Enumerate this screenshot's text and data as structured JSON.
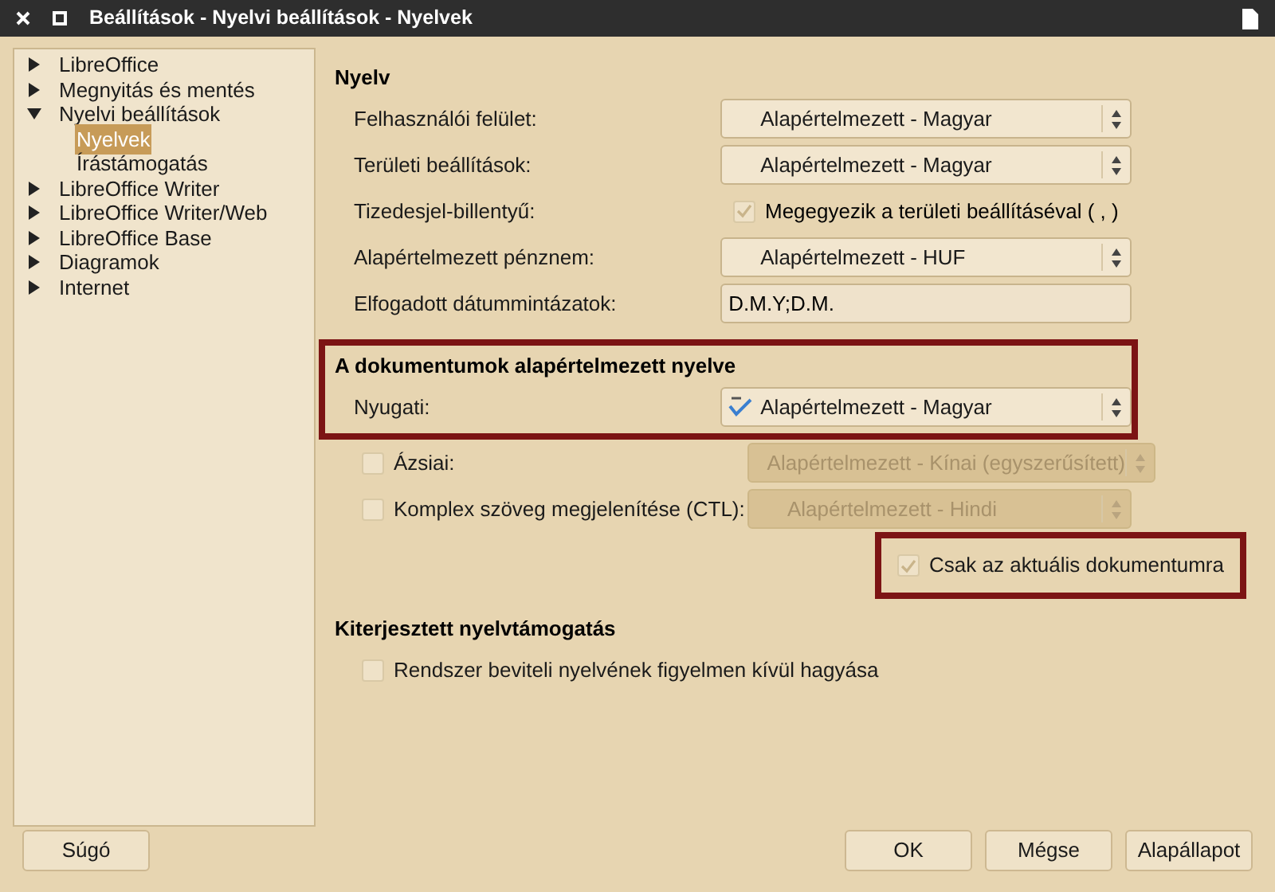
{
  "window": {
    "title": "Beállítások - Nyelvi beállítások - Nyelvek"
  },
  "tree": [
    {
      "label": "LibreOffice",
      "expanded": false,
      "selected": false
    },
    {
      "label": "Megnyitás és mentés",
      "expanded": false,
      "selected": false
    },
    {
      "label": "Nyelvi beállítások",
      "expanded": true,
      "selected": false,
      "children": [
        {
          "label": "Nyelvek",
          "selected": true
        },
        {
          "label": "Írástámogatás",
          "selected": false
        }
      ]
    },
    {
      "label": "LibreOffice Writer",
      "expanded": false,
      "selected": false
    },
    {
      "label": "LibreOffice Writer/Web",
      "expanded": false,
      "selected": false
    },
    {
      "label": "LibreOffice Base",
      "expanded": false,
      "selected": false
    },
    {
      "label": "Diagramok",
      "expanded": false,
      "selected": false
    },
    {
      "label": "Internet",
      "expanded": false,
      "selected": false
    }
  ],
  "sections": [
    {
      "title": "Nyelv",
      "highlighted": false,
      "rows": [
        {
          "kind": "dropdown",
          "label": "Felhasználói felület:",
          "value": "Alapértelmezett - Magyar",
          "disabled": false,
          "spellcheck": false,
          "highlighted": false
        },
        {
          "kind": "dropdown",
          "label": "Területi beállítások:",
          "value": "Alapértelmezett - Magyar",
          "disabled": false,
          "spellcheck": false,
          "highlighted": false
        },
        {
          "kind": "label_checkbox",
          "label": "Tizedesjel-billentyű:",
          "checkbox_label": "Megegyezik a területi beállításéval ( , )",
          "checked": true,
          "highlighted": false
        },
        {
          "kind": "dropdown",
          "label": "Alapértelmezett pénznem:",
          "value": "Alapértelmezett - HUF",
          "disabled": false,
          "spellcheck": false,
          "highlighted": false
        },
        {
          "kind": "text",
          "label": "Elfogadott dátummintázatok:",
          "value": "D.M.Y;D.M.",
          "highlighted": false
        }
      ]
    },
    {
      "title": "A dokumentumok alapértelmezett nyelve",
      "highlighted": true,
      "rows": [
        {
          "kind": "dropdown",
          "label": "Nyugati:",
          "value": "Alapértelmezett - Magyar",
          "disabled": false,
          "spellcheck": true,
          "highlighted": true
        },
        {
          "kind": "checkbox_dropdown",
          "label": "Ázsiai:",
          "value": "Alapértelmezett - Kínai (egyszerűsített)",
          "checked": false,
          "disabled": true,
          "spellcheck": false,
          "highlighted": false
        },
        {
          "kind": "checkbox_dropdown",
          "label": "Komplex szöveg megjelenítése (CTL):",
          "value": "Alapértelmezett - Hindi",
          "checked": false,
          "disabled": true,
          "spellcheck": false,
          "highlighted": false
        },
        {
          "kind": "checkbox_right",
          "label": "Csak az aktuális dokumentumra",
          "checked": true,
          "highlighted": true
        }
      ]
    },
    {
      "title": "Kiterjesztett nyelvtámogatás",
      "highlighted": false,
      "rows": [
        {
          "kind": "checkbox",
          "label": "Rendszer beviteli nyelvének figyelmen kívül hagyása",
          "checked": false,
          "highlighted": false
        }
      ]
    }
  ],
  "help_button": {
    "label": "Súgó"
  },
  "buttons": [
    {
      "label": "OK"
    },
    {
      "label": "Mégse"
    },
    {
      "label": "Alapállapot"
    }
  ]
}
